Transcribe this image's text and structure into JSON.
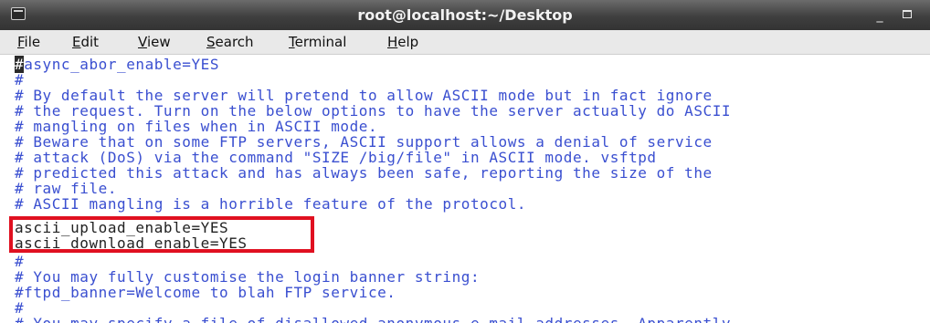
{
  "window": {
    "title": "root@localhost:~/Desktop",
    "minimize_symbol": "_"
  },
  "menu": {
    "file": "File",
    "edit": "Edit",
    "view": "View",
    "search": "Search",
    "terminal": "Terminal",
    "help": "Help"
  },
  "terminal": {
    "cursor_char": "#",
    "lines": [
      "async_abor_enable=YES",
      "#",
      "# By default the server will pretend to allow ASCII mode but in fact ignore",
      "# the request. Turn on the below options to have the server actually do ASCII",
      "# mangling on files when in ASCII mode.",
      "# Beware that on some FTP servers, ASCII support allows a denial of service",
      "# attack (DoS) via the command \"SIZE /big/file\" in ASCII mode. vsftpd",
      "# predicted this attack and has always been safe, reporting the size of the",
      "# raw file.",
      "# ASCII mangling is a horrible feature of the protocol.",
      "ascii_upload_enable=YES",
      "ascii_download_enable=YES",
      "#",
      "# You may fully customise the login banner string:",
      "#ftpd_banner=Welcome to blah FTP service.",
      "#",
      "# You may specify a file of disallowed anonymous e-mail addresses. Apparently"
    ]
  },
  "colors": {
    "comment": "#3a4fd0",
    "plain": "#222222",
    "highlight_border": "#e01020"
  }
}
